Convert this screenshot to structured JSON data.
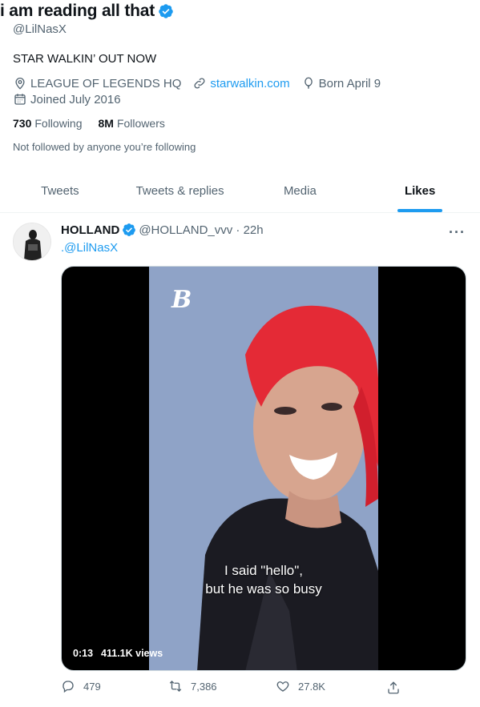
{
  "profile": {
    "display_name": "i am reading all that",
    "handle": "@LilNasX",
    "bio": "STAR WALKIN’ OUT NOW",
    "location": "LEAGUE OF LEGENDS HQ",
    "website": "starwalkin.com",
    "birthday": "Born April 9",
    "joined": "Joined July 2016",
    "following_count": "730",
    "following_label": "Following",
    "followers_count": "8M",
    "followers_label": "Followers",
    "not_followed_text": "Not followed by anyone you’re following"
  },
  "tabs": [
    {
      "label": "Tweets",
      "active": false
    },
    {
      "label": "Tweets & replies",
      "active": false
    },
    {
      "label": "Media",
      "active": false
    },
    {
      "label": "Likes",
      "active": true
    }
  ],
  "tweet": {
    "author": "HOLLAND",
    "handle_time": "@HOLLAND_vvv · 22h",
    "text": ".@LilNasX",
    "more_icon": "ellipsis-icon",
    "media": {
      "logo": "B",
      "caption_line1": "I said \"hello\",",
      "caption_line2": "but he was so busy",
      "duration": "0:13",
      "views": "411.1K views"
    },
    "actions": {
      "replies": "479",
      "retweets": "7,386",
      "likes": "27.8K"
    }
  },
  "colors": {
    "accent": "#1d9bf0",
    "text_primary": "#0f1419",
    "text_secondary": "#536471"
  }
}
